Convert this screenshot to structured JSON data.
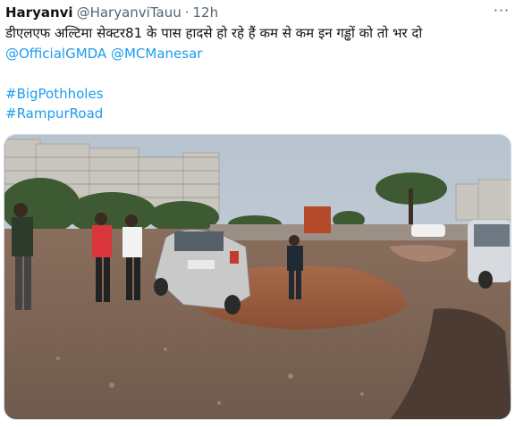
{
  "tweet": {
    "author_name": "Haryanvi",
    "author_handle": "@HaryanviTauu",
    "separator": "·",
    "timestamp": "12h",
    "more_icon": "more-horizontal-icon",
    "text_line1": "डीएलएफ अल्टिमा सेक्टर81 के पास हादसे हो रहे हैं कम से कम इन गड्ढों को तो भर दो",
    "mentions": [
      "@OfficialGMDA",
      "@MCManesar"
    ],
    "hashtags": [
      "#BigPothholes",
      "#RampurRoad"
    ]
  },
  "colors": {
    "text": "#0f1419",
    "secondary": "#536471",
    "link": "#1d9bf0",
    "border": "#cfd9de"
  }
}
